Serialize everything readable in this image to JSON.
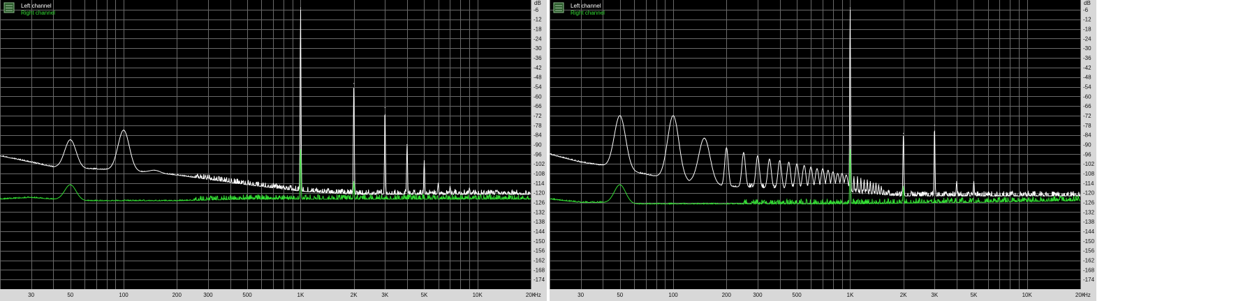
{
  "chart_data": [
    {
      "type": "line",
      "title": "",
      "xlabel": "Hz",
      "ylabel": "dB",
      "x_scale": "log",
      "xlim": [
        20,
        20000
      ],
      "ylim": [
        -180,
        0
      ],
      "grid": true,
      "legend_position": "top-left",
      "legend_icon": "spectrum-icon",
      "background_color": "#000000",
      "x_tick_labels": [
        {
          "value": 30,
          "label": "30"
        },
        {
          "value": 50,
          "label": "50"
        },
        {
          "value": 100,
          "label": "100"
        },
        {
          "value": 200,
          "label": "200"
        },
        {
          "value": 300,
          "label": "300"
        },
        {
          "value": 500,
          "label": "500"
        },
        {
          "value": 1000,
          "label": "1K"
        },
        {
          "value": 2000,
          "label": "2K"
        },
        {
          "value": 3000,
          "label": "3K"
        },
        {
          "value": 5000,
          "label": "5K"
        },
        {
          "value": 10000,
          "label": "10K"
        },
        {
          "value": 20000,
          "label": "20K"
        }
      ],
      "y_tick_labels": [
        "-6",
        "-12",
        "-18",
        "-24",
        "-30",
        "-36",
        "-42",
        "-48",
        "-54",
        "-60",
        "-66",
        "-72",
        "-78",
        "-84",
        "-90",
        "-96",
        "-102",
        "-108",
        "-114",
        "-120",
        "-126",
        "-132",
        "-138",
        "-144",
        "-150",
        "-156",
        "-162",
        "-168",
        "-174"
      ],
      "series": [
        {
          "name": "Left channel",
          "color": "#ffffff",
          "floor": [
            [
              20,
              -97
            ],
            [
              30,
              -101
            ],
            [
              40,
              -104
            ],
            [
              60,
              -105
            ],
            [
              100,
              -106
            ],
            [
              200,
              -109
            ],
            [
              500,
              -115
            ],
            [
              1000,
              -119
            ],
            [
              2000,
              -121
            ],
            [
              20000,
              -121
            ]
          ],
          "peaks": [
            [
              50,
              -87
            ],
            [
              100,
              -81
            ],
            [
              150,
              -106
            ],
            [
              1000,
              -5
            ],
            [
              2000,
              -52
            ],
            [
              3000,
              -67
            ],
            [
              4000,
              -90
            ],
            [
              5000,
              -100
            ],
            [
              6000,
              -114
            ],
            [
              7000,
              -116
            ],
            [
              9000,
              -117
            ]
          ]
        },
        {
          "name": "Right channel",
          "color": "#33dd33",
          "floor": [
            [
              20,
              -124
            ],
            [
              30,
              -123
            ],
            [
              40,
              -124
            ],
            [
              60,
              -125
            ],
            [
              100,
              -125
            ],
            [
              200,
              -125
            ],
            [
              500,
              -124
            ],
            [
              1000,
              -124
            ],
            [
              20000,
              -124
            ]
          ],
          "peaks": [
            [
              50,
              -115
            ],
            [
              1000,
              -93
            ],
            [
              2000,
              -113
            ]
          ]
        }
      ]
    },
    {
      "type": "line",
      "title": "",
      "xlabel": "Hz",
      "ylabel": "dB",
      "x_scale": "log",
      "xlim": [
        20,
        20000
      ],
      "ylim": [
        -180,
        0
      ],
      "grid": true,
      "legend_position": "top-left",
      "legend_icon": "spectrum-icon",
      "background_color": "#000000",
      "x_tick_labels": [
        {
          "value": 30,
          "label": "30"
        },
        {
          "value": 50,
          "label": "50"
        },
        {
          "value": 100,
          "label": "100"
        },
        {
          "value": 200,
          "label": "200"
        },
        {
          "value": 300,
          "label": "300"
        },
        {
          "value": 500,
          "label": "500"
        },
        {
          "value": 1000,
          "label": "1K"
        },
        {
          "value": 2000,
          "label": "2K"
        },
        {
          "value": 3000,
          "label": "3K"
        },
        {
          "value": 5000,
          "label": "5K"
        },
        {
          "value": 10000,
          "label": "10K"
        },
        {
          "value": 20000,
          "label": "20K"
        }
      ],
      "y_tick_labels": [
        "-6",
        "-12",
        "-18",
        "-24",
        "-30",
        "-36",
        "-42",
        "-48",
        "-54",
        "-60",
        "-66",
        "-72",
        "-78",
        "-84",
        "-90",
        "-96",
        "-102",
        "-108",
        "-114",
        "-120",
        "-126",
        "-132",
        "-138",
        "-144",
        "-150",
        "-156",
        "-162",
        "-168",
        "-174"
      ],
      "series": [
        {
          "name": "Left channel",
          "color": "#ffffff",
          "floor": [
            [
              20,
              -96
            ],
            [
              30,
              -101
            ],
            [
              40,
              -103
            ],
            [
              60,
              -107
            ],
            [
              100,
              -112
            ],
            [
              200,
              -116
            ],
            [
              500,
              -118
            ],
            [
              1000,
              -120
            ],
            [
              2000,
              -122
            ],
            [
              20000,
              -122
            ]
          ],
          "peaks": [
            [
              50,
              -72
            ],
            [
              100,
              -72
            ],
            [
              150,
              -86
            ],
            [
              200,
              -92
            ],
            [
              250,
              -95
            ],
            [
              300,
              -97
            ],
            [
              350,
              -99
            ],
            [
              400,
              -100
            ],
            [
              450,
              -101
            ],
            [
              500,
              -102
            ],
            [
              550,
              -103
            ],
            [
              600,
              -104
            ],
            [
              650,
              -105
            ],
            [
              700,
              -105
            ],
            [
              750,
              -106
            ],
            [
              800,
              -107
            ],
            [
              850,
              -108
            ],
            [
              900,
              -108
            ],
            [
              950,
              -109
            ],
            [
              1000,
              -5
            ],
            [
              1050,
              -110
            ],
            [
              1100,
              -110
            ],
            [
              1150,
              -111
            ],
            [
              1200,
              -112
            ],
            [
              1250,
              -112
            ],
            [
              1300,
              -113
            ],
            [
              1350,
              -114
            ],
            [
              1400,
              -114
            ],
            [
              1450,
              -115
            ],
            [
              1500,
              -116
            ],
            [
              2000,
              -83
            ],
            [
              3000,
              -78
            ],
            [
              4000,
              -113
            ],
            [
              5000,
              -113
            ]
          ]
        },
        {
          "name": "Right channel",
          "color": "#33dd33",
          "floor": [
            [
              20,
              -124
            ],
            [
              30,
              -126
            ],
            [
              40,
              -126
            ],
            [
              60,
              -127
            ],
            [
              100,
              -127
            ],
            [
              200,
              -127
            ],
            [
              500,
              -127
            ],
            [
              1000,
              -127
            ],
            [
              20000,
              -125
            ]
          ],
          "peaks": [
            [
              50,
              -115
            ],
            [
              1000,
              -93
            ],
            [
              2000,
              -116
            ]
          ]
        }
      ]
    }
  ]
}
